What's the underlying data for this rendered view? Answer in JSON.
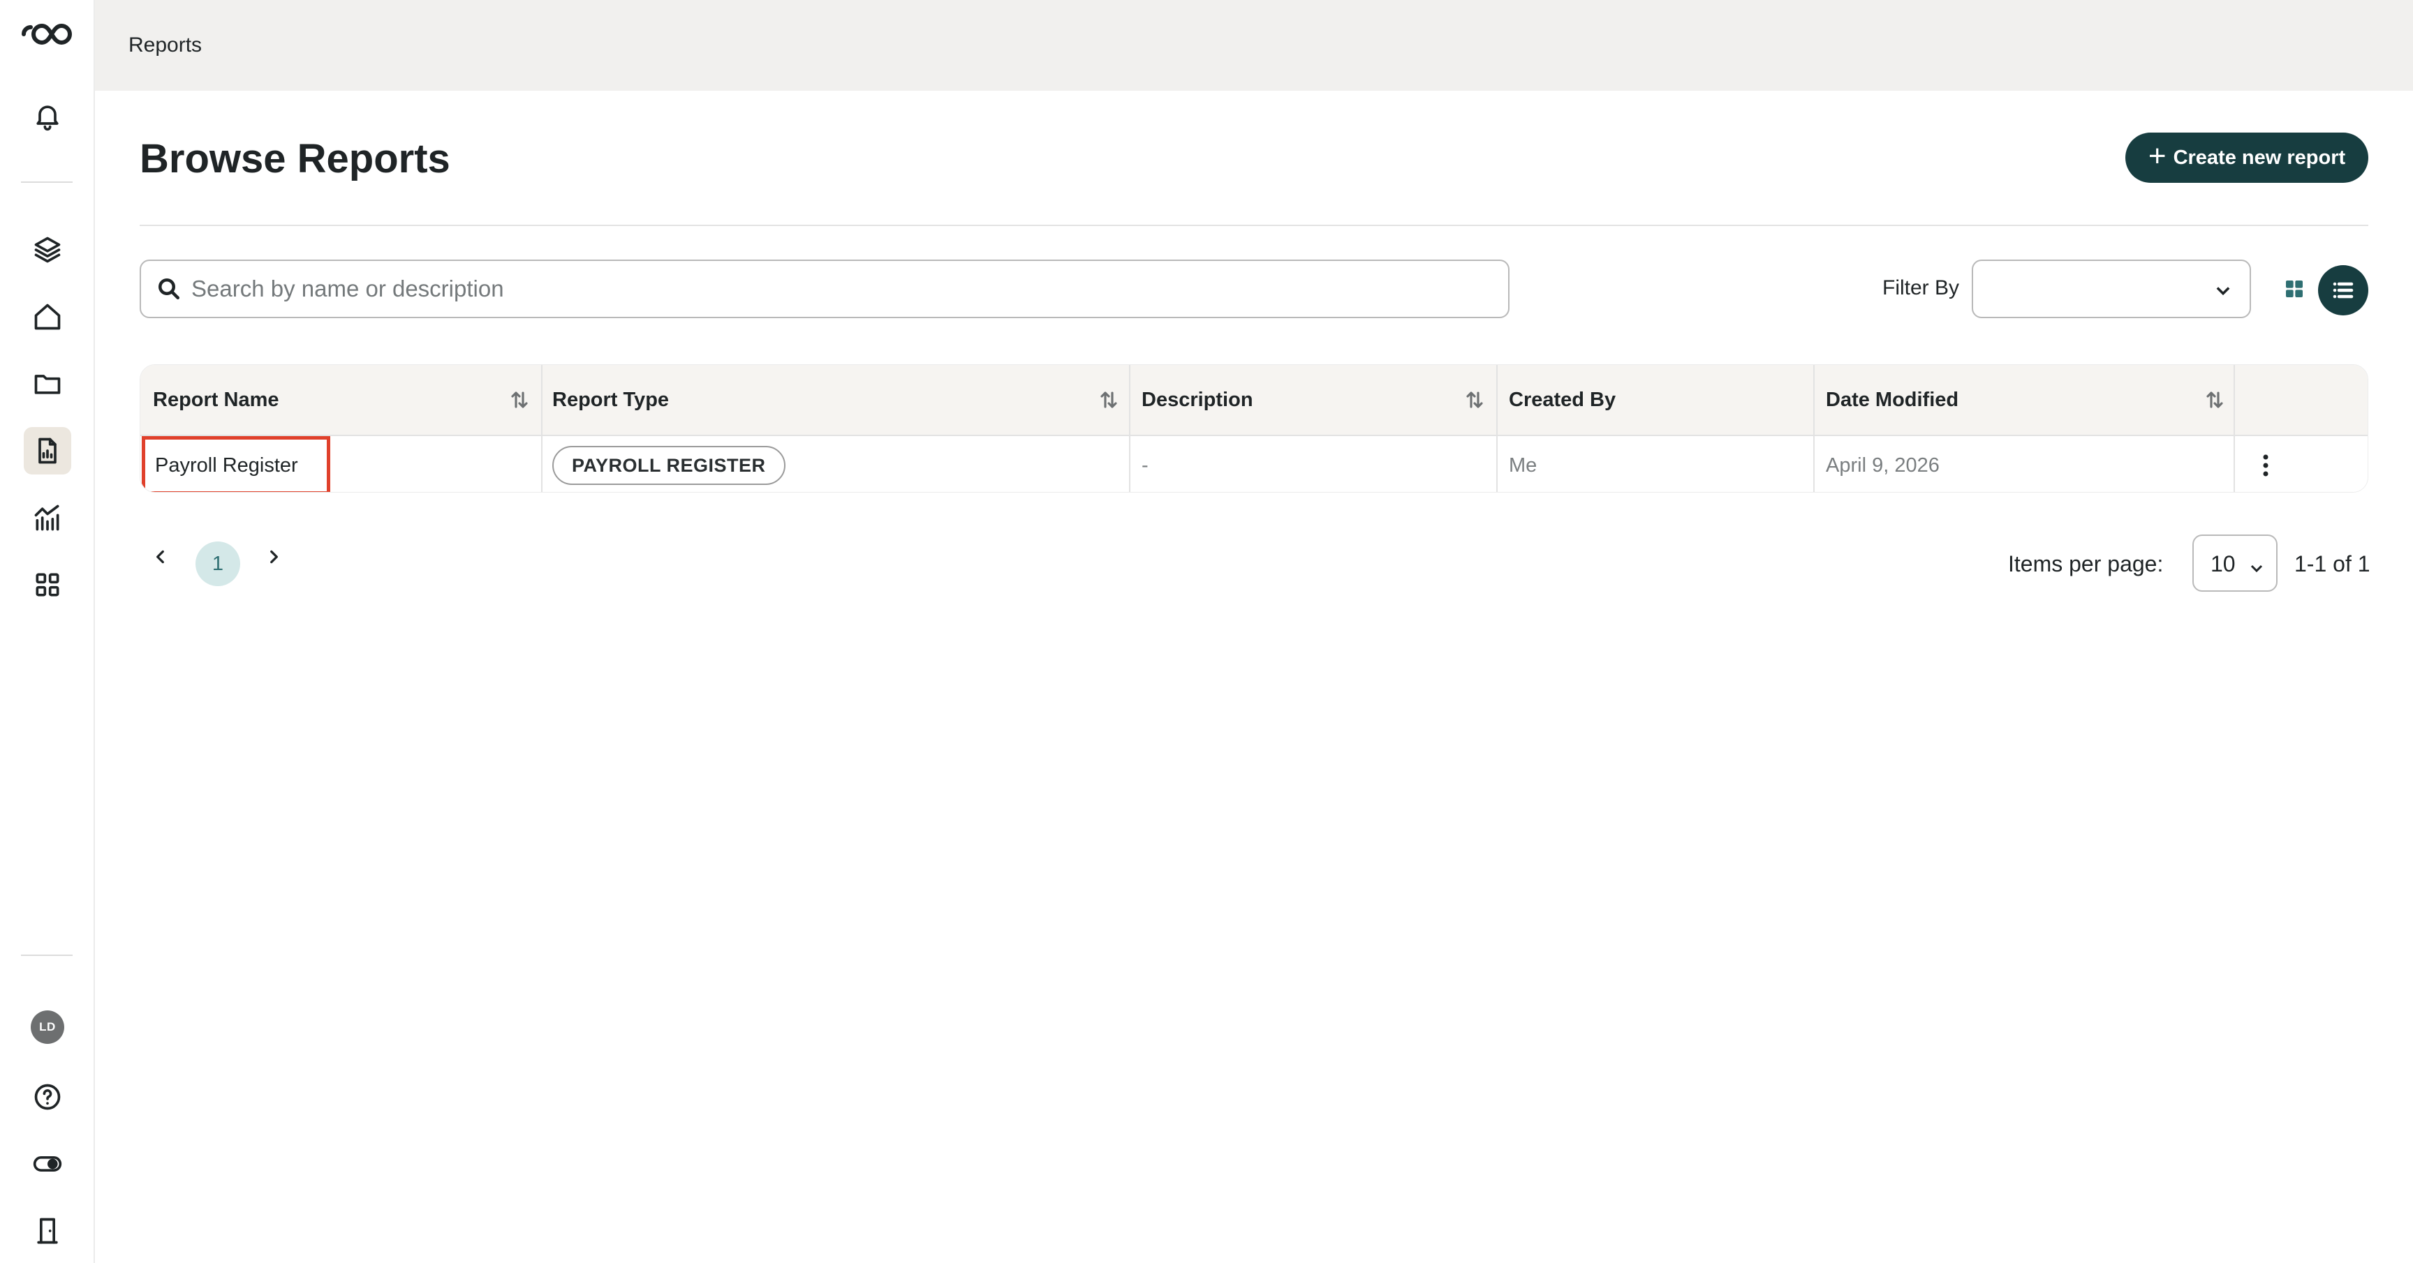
{
  "sidebar": {
    "logo": "logo-icon",
    "items": [
      "bell-icon",
      "layers-icon",
      "home-icon",
      "folder-icon",
      "report-icon",
      "analytics-icon",
      "apps-icon"
    ],
    "active_item": "report-icon",
    "avatar_initials": "LD",
    "bottom_items": [
      "help-icon",
      "toggle-icon",
      "exit-door-icon"
    ]
  },
  "topbar": {
    "breadcrumb": "Reports"
  },
  "main": {
    "title": "Browse Reports",
    "create_button_label": "Create new report",
    "search_placeholder": "Search by name or description",
    "filter_label": "Filter By",
    "filter_value": ""
  },
  "table": {
    "columns": [
      "Report Name",
      "Report Type",
      "Description",
      "Created By",
      "Date Modified"
    ],
    "rows": [
      {
        "name": "Payroll Register",
        "type": "PAYROLL REGISTER",
        "description": "-",
        "created_by": "Me",
        "date_modified": "April 9, 2026"
      }
    ]
  },
  "pagination": {
    "current_page": "1",
    "items_per_page_label": "Items per page:",
    "items_per_page": "10",
    "range": "1-1 of 1"
  },
  "colors": {
    "primary": "#173d40",
    "highlight": "#e0402b",
    "page_badge": "#d4e8e8",
    "header_bg": "#f1f0ee"
  }
}
